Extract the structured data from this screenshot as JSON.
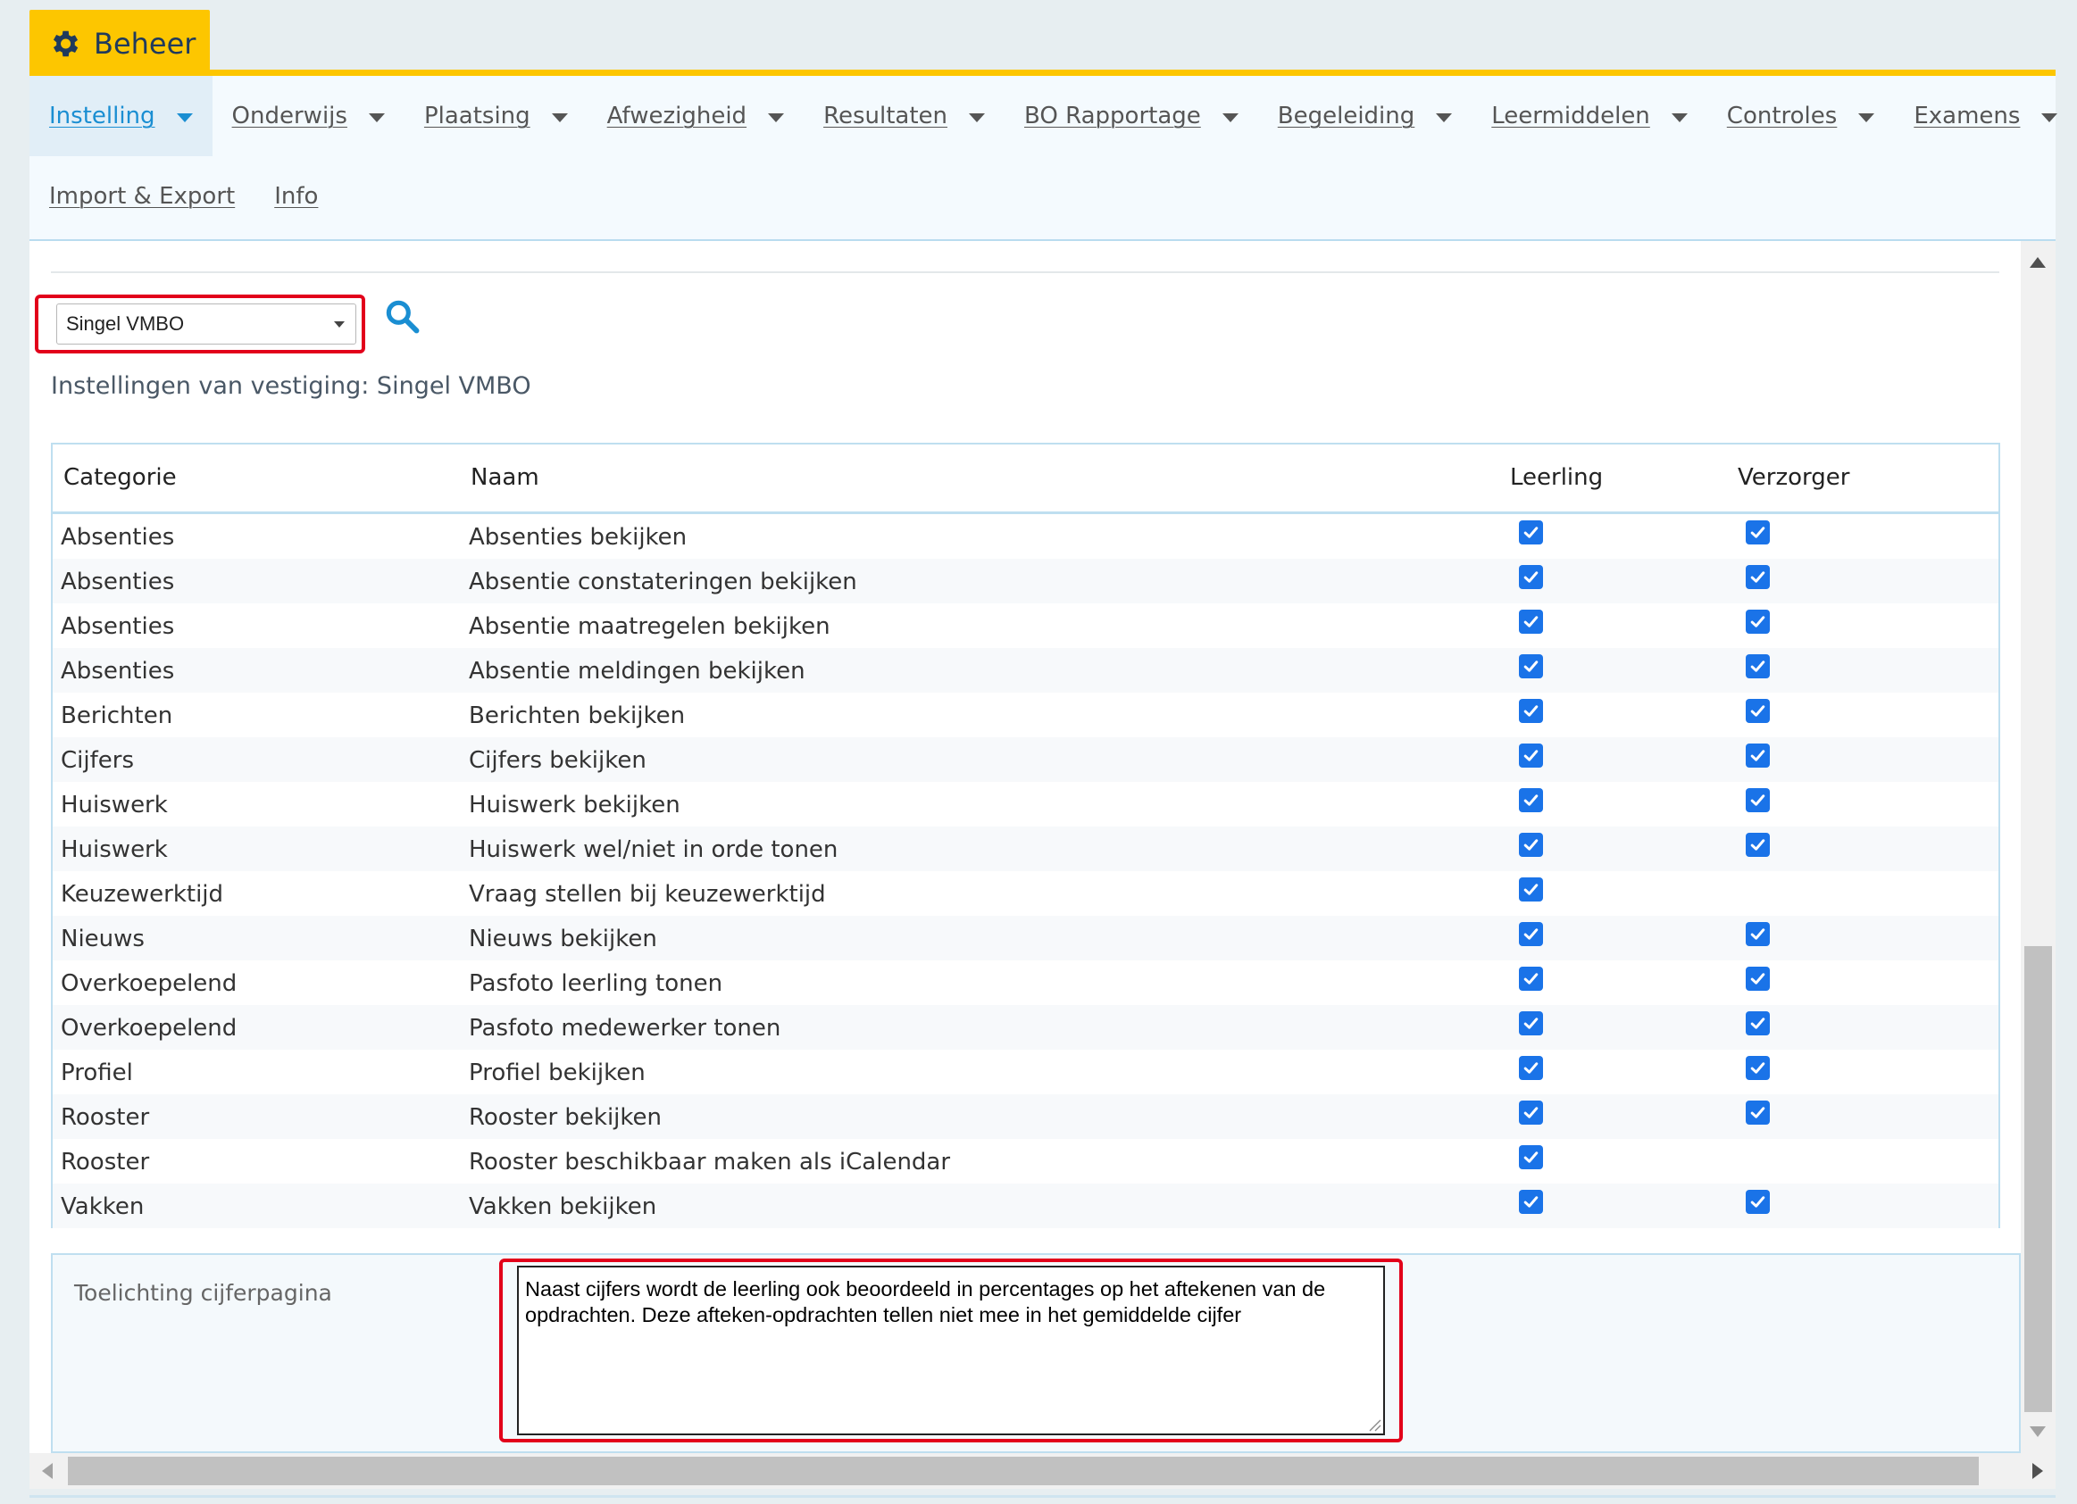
{
  "app": {
    "title": "Beheer",
    "icon": "gear-icon",
    "accent_color": "#fdc600",
    "link_color": "#1a8ed2"
  },
  "menu": {
    "row1": [
      {
        "label": "Instelling",
        "active": true
      },
      {
        "label": "Onderwijs"
      },
      {
        "label": "Plaatsing"
      },
      {
        "label": "Afwezigheid"
      },
      {
        "label": "Resultaten"
      },
      {
        "label": "BO Rapportage"
      },
      {
        "label": "Begeleiding"
      },
      {
        "label": "Leermiddelen"
      },
      {
        "label": "Controles"
      },
      {
        "label": "Examens"
      }
    ],
    "row2": [
      {
        "label": "Import & Export"
      },
      {
        "label": "Info"
      }
    ]
  },
  "location": {
    "selected": "Singel VMBO",
    "search_icon": "search-icon"
  },
  "section_title": "Instellingen van vestiging: Singel VMBO",
  "table": {
    "headers": {
      "categorie": "Categorie",
      "naam": "Naam",
      "leerling": "Leerling",
      "verzorger": "Verzorger"
    },
    "rows": [
      {
        "categorie": "Absenties",
        "naam": "Absenties bekijken",
        "leerling": true,
        "verzorger": true
      },
      {
        "categorie": "Absenties",
        "naam": "Absentie constateringen bekijken",
        "leerling": true,
        "verzorger": true
      },
      {
        "categorie": "Absenties",
        "naam": "Absentie maatregelen bekijken",
        "leerling": true,
        "verzorger": true
      },
      {
        "categorie": "Absenties",
        "naam": "Absentie meldingen bekijken",
        "leerling": true,
        "verzorger": true
      },
      {
        "categorie": "Berichten",
        "naam": "Berichten bekijken",
        "leerling": true,
        "verzorger": true
      },
      {
        "categorie": "Cijfers",
        "naam": "Cijfers bekijken",
        "leerling": true,
        "verzorger": true
      },
      {
        "categorie": "Huiswerk",
        "naam": "Huiswerk bekijken",
        "leerling": true,
        "verzorger": true
      },
      {
        "categorie": "Huiswerk",
        "naam": "Huiswerk wel/niet in orde tonen",
        "leerling": true,
        "verzorger": true
      },
      {
        "categorie": "Keuzewerktijd",
        "naam": "Vraag stellen bij keuzewerktijd",
        "leerling": true,
        "verzorger": false
      },
      {
        "categorie": "Nieuws",
        "naam": "Nieuws bekijken",
        "leerling": true,
        "verzorger": true
      },
      {
        "categorie": "Overkoepelend",
        "naam": "Pasfoto leerling tonen",
        "leerling": true,
        "verzorger": true
      },
      {
        "categorie": "Overkoepelend",
        "naam": "Pasfoto medewerker tonen",
        "leerling": true,
        "verzorger": true
      },
      {
        "categorie": "Profiel",
        "naam": "Profiel bekijken",
        "leerling": true,
        "verzorger": true
      },
      {
        "categorie": "Rooster",
        "naam": "Rooster bekijken",
        "leerling": true,
        "verzorger": true
      },
      {
        "categorie": "Rooster",
        "naam": "Rooster beschikbaar maken als iCalendar",
        "leerling": true,
        "verzorger": false
      },
      {
        "categorie": "Vakken",
        "naam": "Vakken bekijken",
        "leerling": true,
        "verzorger": true
      }
    ]
  },
  "note": {
    "label": "Toelichting cijferpagina",
    "value": "Naast cijfers wordt de leerling ook beoordeeld in percentages op het aftekenen van de opdrachten. Deze afteken-opdrachten tellen niet mee in het gemiddelde cijfer"
  },
  "highlight_color": "#e2001a"
}
